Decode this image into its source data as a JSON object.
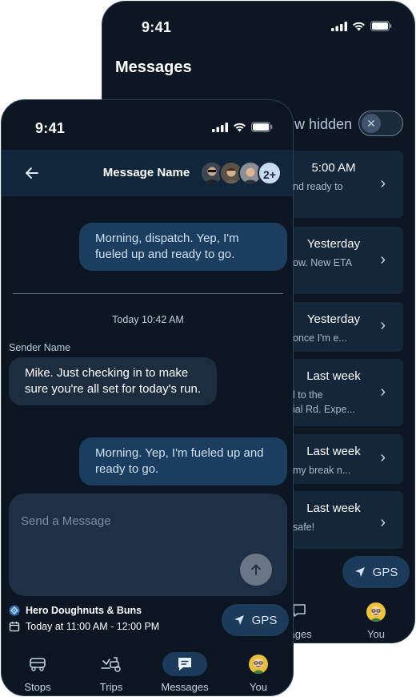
{
  "status_bar": {
    "time": "9:41"
  },
  "back_screen": {
    "title": "Messages",
    "show_hidden_label": "w hidden",
    "toggle_symbol": "✕",
    "conversations": [
      {
        "time": "5:00 AM",
        "preview": "nd ready to"
      },
      {
        "time": "Yesterday",
        "preview": "ow. New ETA"
      },
      {
        "time": "Yesterday",
        "preview": "once I'm e..."
      },
      {
        "time": "Last week",
        "preview": "l to the\nial Rd. Expe..."
      },
      {
        "time": "Last week",
        "preview": "my break n..."
      },
      {
        "time": "Last week",
        "preview": "safe!"
      }
    ],
    "gps_label": "GPS",
    "nav": {
      "messages_label": "sages",
      "you_label": "You"
    }
  },
  "front_screen": {
    "header": {
      "title": "Message Name",
      "participants_more": "2+"
    },
    "messages": [
      {
        "direction": "outgoing",
        "text": "Morning, dispatch. Yep, I'm fueled up and ready to go."
      },
      {
        "direction": "incoming",
        "sender": "Sender Name",
        "text": "Mike. Just checking in to make sure you're all set for today's run."
      },
      {
        "direction": "outgoing",
        "text": "Morning. Yep, I'm fueled up and ready to go."
      }
    ],
    "timestamp_separator": "Today 10:42 AM",
    "composer": {
      "placeholder": "Send a Message"
    },
    "stop": {
      "name": "Hero Doughnuts & Buns",
      "window": "Today at 11:00 AM - 12:00 PM"
    },
    "gps_label": "GPS",
    "nav": [
      {
        "label": "Stops",
        "icon": "truck-icon",
        "active": false
      },
      {
        "label": "Trips",
        "icon": "trips-icon",
        "active": false
      },
      {
        "label": "Messages",
        "icon": "chat-icon",
        "active": true
      },
      {
        "label": "You",
        "icon": "avatar",
        "active": false
      }
    ]
  },
  "colors": {
    "background": "#0b1622",
    "outgoing_bubble": "#1a3d60",
    "incoming_bubble": "#1d2d3f",
    "accent_pill": "#1c3a59"
  }
}
